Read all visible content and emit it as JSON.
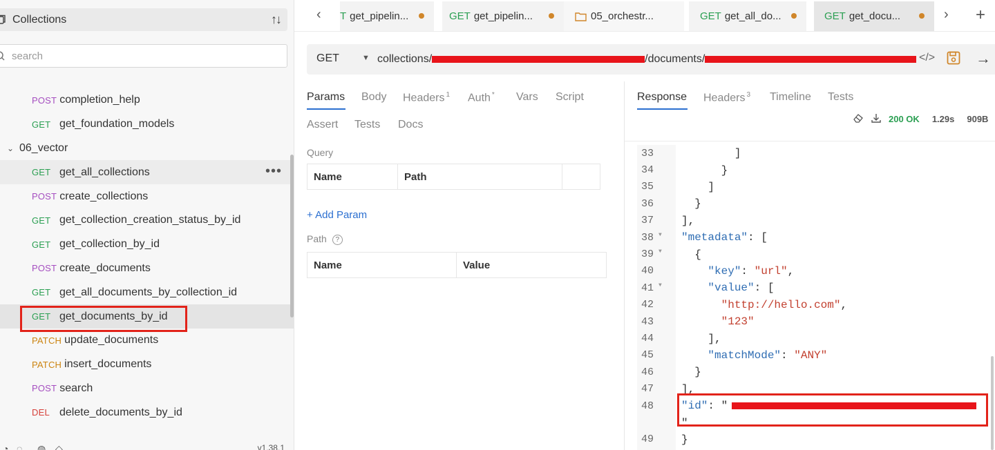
{
  "sidebar": {
    "title": "Collections",
    "search_placeholder": "search",
    "partial_row": "' .",
    "rows": [
      {
        "type": "request",
        "method": "POST",
        "name": "completion_help"
      },
      {
        "type": "request",
        "method": "GET",
        "name": "get_foundation_models"
      },
      {
        "type": "folder",
        "name": "06_vector"
      },
      {
        "type": "request",
        "method": "GET",
        "name": "get_all_collections"
      },
      {
        "type": "request",
        "method": "POST",
        "name": "create_collections"
      },
      {
        "type": "request",
        "method": "GET",
        "name": "get_collection_creation_status_by_id"
      },
      {
        "type": "request",
        "method": "GET",
        "name": "get_collection_by_id"
      },
      {
        "type": "request",
        "method": "POST",
        "name": "create_documents"
      },
      {
        "type": "request",
        "method": "GET",
        "name": "get_all_documents_by_collection_id"
      },
      {
        "type": "request",
        "method": "GET",
        "name": "get_documents_by_id"
      },
      {
        "type": "request",
        "method": "PATCH",
        "name": "update_documents"
      },
      {
        "type": "request",
        "method": "PATCH",
        "name": "insert_documents"
      },
      {
        "type": "request",
        "method": "POST",
        "name": "search"
      },
      {
        "type": "request",
        "method": "DEL",
        "name": "delete_documents_by_id"
      }
    ],
    "version": "v1.38.1"
  },
  "tabs": [
    {
      "method": "T",
      "name": "get_pipelin..."
    },
    {
      "method": "GET",
      "name": "get_pipelin..."
    },
    {
      "method": "",
      "name": "05_orchestr..."
    },
    {
      "method": "GET",
      "name": "get_all_do..."
    },
    {
      "method": "GET",
      "name": "get_docu..."
    }
  ],
  "url": {
    "method": "GET",
    "prefix": "collections/",
    "middle": "/documents/",
    "suffix": ""
  },
  "request": {
    "tabs": [
      "Params",
      "Body",
      "Headers",
      "Auth",
      "Vars",
      "Script",
      "Assert",
      "Tests",
      "Docs"
    ],
    "headers_count": "1",
    "auth_mark": "*",
    "query_label": "Query",
    "query_columns": [
      "Name",
      "Path"
    ],
    "add_param": "+ Add Param",
    "path_label": "Path",
    "path_columns": [
      "Name",
      "Value"
    ]
  },
  "response": {
    "tabs": [
      "Response",
      "Headers",
      "Timeline",
      "Tests"
    ],
    "headers_count": "3",
    "status": "200 OK",
    "time": "1.29s",
    "size": "909B"
  },
  "code_lines": [
    {
      "n": "33",
      "fold": false,
      "text": "        ]"
    },
    {
      "n": "34",
      "fold": false,
      "text": "      }"
    },
    {
      "n": "35",
      "fold": false,
      "text": "    ]"
    },
    {
      "n": "36",
      "fold": false,
      "text": "  }"
    },
    {
      "n": "37",
      "fold": false,
      "text": "],"
    },
    {
      "n": "38",
      "fold": true,
      "text": "\"metadata\": ["
    },
    {
      "n": "39",
      "fold": true,
      "text": "  {"
    },
    {
      "n": "40",
      "fold": false,
      "text": "    \"key\": \"url\","
    },
    {
      "n": "41",
      "fold": true,
      "text": "    \"value\": ["
    },
    {
      "n": "42",
      "fold": false,
      "text": "      \"http://hello.com\","
    },
    {
      "n": "43",
      "fold": false,
      "text": "      \"123\""
    },
    {
      "n": "44",
      "fold": false,
      "text": "    ],"
    },
    {
      "n": "45",
      "fold": false,
      "text": "    \"matchMode\": \"ANY\""
    },
    {
      "n": "46",
      "fold": false,
      "text": "  }"
    },
    {
      "n": "47",
      "fold": false,
      "text": "],"
    },
    {
      "n": "48",
      "fold": false,
      "text": "\"id\": \""
    },
    {
      "n": "",
      "fold": false,
      "text": "\""
    },
    {
      "n": "49",
      "fold": false,
      "text": "}"
    }
  ]
}
